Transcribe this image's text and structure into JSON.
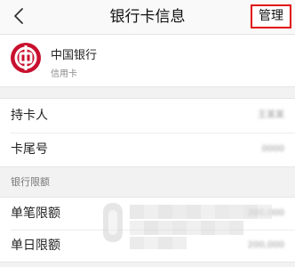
{
  "navbar": {
    "title": "银行卡信息",
    "back_icon": "chevron-left-icon",
    "manage_label": "管理"
  },
  "bank": {
    "name": "中国银行",
    "card_type": "信用卡",
    "logo_icon": "bank-of-china-logo",
    "brand_color": "#c8102e"
  },
  "info_rows": [
    {
      "label": "持卡人",
      "value": "王某某"
    },
    {
      "label": "卡尾号",
      "value": "0000"
    }
  ],
  "limits": {
    "section_label": "银行限额",
    "rows": [
      {
        "label": "单笔限额",
        "value": "200,000"
      },
      {
        "label": "单日限额",
        "value": "200,000"
      }
    ]
  }
}
